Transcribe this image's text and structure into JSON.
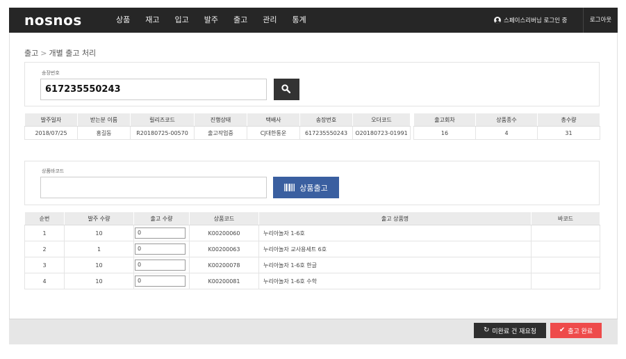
{
  "navbar": {
    "logo": "nosnos",
    "menu": [
      "상품",
      "재고",
      "입고",
      "발주",
      "출고",
      "관리",
      "통계"
    ],
    "user_status": "스페이스리버님 로그인 중",
    "logout": "로그아웃"
  },
  "breadcrumb": {
    "parent": "출고",
    "separator": ">",
    "current": "개별 출고 처리"
  },
  "invoice": {
    "label": "송장번호",
    "value": "617235550243"
  },
  "order_table": {
    "headers": [
      "발주일자",
      "받는분 이름",
      "릴리즈코드",
      "진행상태",
      "택배사",
      "송장번호",
      "오더코드"
    ],
    "row": [
      "2018/07/25",
      "홍길동",
      "R20180725-00570",
      "출고작업중",
      "CJ대한통운",
      "617235550243",
      "O20180723-01991"
    ]
  },
  "summary_table": {
    "headers": [
      "출고회차",
      "상품종수",
      "총수량"
    ],
    "row": [
      "16",
      "4",
      "31"
    ]
  },
  "barcode": {
    "label": "상품바코드",
    "value": "",
    "button_label": "상품출고"
  },
  "items_table": {
    "headers": [
      "순번",
      "발주 수량",
      "출고 수량",
      "상품코드",
      "출고 상품명",
      "바코드"
    ],
    "rows": [
      {
        "seq": "1",
        "order_qty": "10",
        "ship_qty": "0",
        "code": "K00200060",
        "name": "누리아놀자 1-6호",
        "barcode": ""
      },
      {
        "seq": "2",
        "order_qty": "1",
        "ship_qty": "0",
        "code": "K00200063",
        "name": "누리아놀자 교사용세트 6호",
        "barcode": ""
      },
      {
        "seq": "3",
        "order_qty": "10",
        "ship_qty": "0",
        "code": "K00200078",
        "name": "누리아놀자 1-6호 한글",
        "barcode": ""
      },
      {
        "seq": "4",
        "order_qty": "10",
        "ship_qty": "0",
        "code": "K00200081",
        "name": "누리아놀자 1-6호 수학",
        "barcode": ""
      }
    ]
  },
  "footer": {
    "rerequest_label": "미완료 건 재요청",
    "complete_label": "출고 완료"
  },
  "colors": {
    "navbar": "#262626",
    "ship_button": "#3a5fa0",
    "complete_button": "#ee4b4b",
    "rerequest_button": "#2f2f2f"
  }
}
